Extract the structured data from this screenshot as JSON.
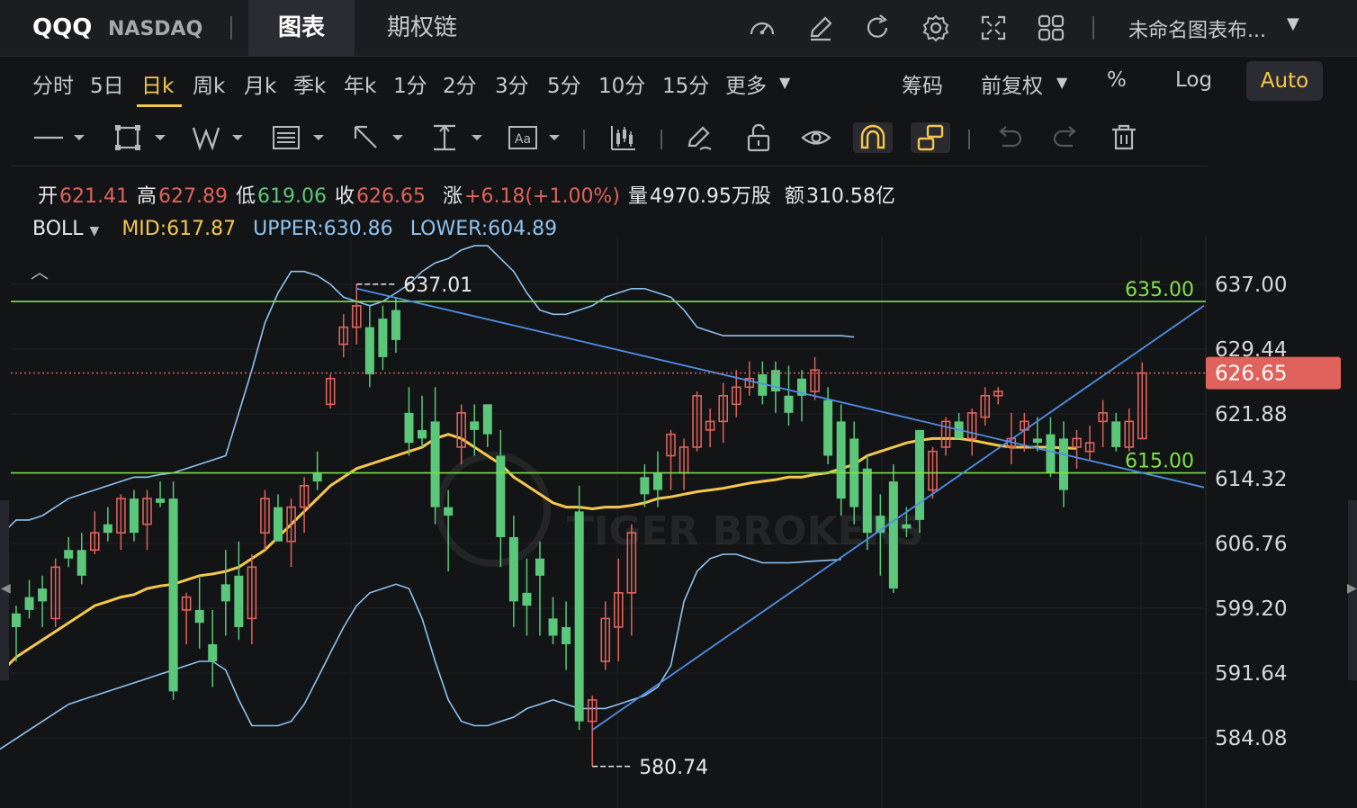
{
  "header": {
    "symbol": "QQQ",
    "exchange": "NASDAQ",
    "tabs": [
      {
        "label": "图表",
        "active": true
      },
      {
        "label": "期权链",
        "active": false
      }
    ],
    "layout_name": "未命名图表布...",
    "icons": [
      "gauge-icon",
      "pencil-icon",
      "refresh-icon",
      "settings-icon",
      "fullscreen-icon",
      "grid-layout-icon"
    ]
  },
  "periods": {
    "items": [
      "分时",
      "5日",
      "日k",
      "周k",
      "月k",
      "季k",
      "年k",
      "1分",
      "2分",
      "3分",
      "5分",
      "10分",
      "15分",
      "更多"
    ],
    "active": "日k",
    "chips": "筹码",
    "adjust": "前复权",
    "percent": "%",
    "log": "Log",
    "auto": "Auto"
  },
  "ohlc": {
    "open_label": "开",
    "open": "621.41",
    "high_label": "高",
    "high": "627.89",
    "low_label": "低",
    "low": "619.06",
    "close_label": "收",
    "close": "626.65",
    "change_label": "涨",
    "change": "+6.18(+1.00%)",
    "volume_label": "量",
    "volume": "4970.95万股",
    "amount_label": "额",
    "amount": "310.58亿"
  },
  "indicator": {
    "name": "BOLL",
    "mid": "MID:617.87",
    "upper": "UPPER:630.86",
    "lower": "LOWER:604.89"
  },
  "colors": {
    "up": "#e0625c",
    "down": "#5bc77b",
    "mid": "#f5c84c",
    "band": "#8ec3f0",
    "trendline": "#4f8fe6",
    "hline": "#7fe04a",
    "accent": "#f5c84c",
    "last_price_bg": "#e0625c"
  },
  "chart_data": {
    "type": "candlestick",
    "y_ticks": [
      "637.00",
      "629.44",
      "621.88",
      "614.32",
      "606.76",
      "599.20",
      "591.64",
      "584.08"
    ],
    "ylim": [
      581.0,
      641.5
    ],
    "last_price": "626.65",
    "hlines": [
      {
        "value": 635.0,
        "label": "635.00"
      },
      {
        "value": 615.0,
        "label": "615.00"
      }
    ],
    "high_marker": {
      "value": "637.01",
      "index": 26
    },
    "low_marker": {
      "value": "580.74",
      "index": 44
    },
    "watermark": "TIGER BROKERS",
    "trendlines": [
      {
        "from": [
          26,
          636.5
        ],
        "to": [
          86,
          615.0
        ]
      },
      {
        "from": [
          44,
          585.0
        ],
        "to": [
          86,
          629.5
        ]
      }
    ],
    "candles": [
      {
        "o": 598.6,
        "h": 599.5,
        "l": 593.0,
        "c": 597.0
      },
      {
        "o": 600.5,
        "h": 602.5,
        "l": 598.0,
        "c": 599.0
      },
      {
        "o": 601.5,
        "h": 603.0,
        "l": 597.0,
        "c": 600.0
      },
      {
        "o": 598.0,
        "h": 605.0,
        "l": 597.0,
        "c": 604.0
      },
      {
        "o": 606.0,
        "h": 607.5,
        "l": 604.0,
        "c": 605.0
      },
      {
        "o": 606.0,
        "h": 608.0,
        "l": 602.0,
        "c": 603.0
      },
      {
        "o": 606.0,
        "h": 610.5,
        "l": 605.5,
        "c": 608.0
      },
      {
        "o": 609.0,
        "h": 611.0,
        "l": 607.0,
        "c": 608.0
      },
      {
        "o": 608.0,
        "h": 612.5,
        "l": 606.0,
        "c": 612.0
      },
      {
        "o": 612.0,
        "h": 613.0,
        "l": 607.0,
        "c": 608.0
      },
      {
        "o": 609.0,
        "h": 613.0,
        "l": 606.0,
        "c": 612.0
      },
      {
        "o": 612.0,
        "h": 614.0,
        "l": 611.0,
        "c": 611.5
      },
      {
        "o": 612.0,
        "h": 614.0,
        "l": 588.5,
        "c": 589.5
      },
      {
        "o": 599.0,
        "h": 601.0,
        "l": 595.0,
        "c": 600.5
      },
      {
        "o": 599.0,
        "h": 603.0,
        "l": 594.5,
        "c": 597.5
      },
      {
        "o": 595.0,
        "h": 599.0,
        "l": 590.0,
        "c": 593.0
      },
      {
        "o": 602.0,
        "h": 606.0,
        "l": 596.0,
        "c": 600.0
      },
      {
        "o": 603.0,
        "h": 607.0,
        "l": 595.5,
        "c": 597.0
      },
      {
        "o": 598.0,
        "h": 605.5,
        "l": 595.0,
        "c": 604.0
      },
      {
        "o": 608.0,
        "h": 613.0,
        "l": 606.0,
        "c": 612.0
      },
      {
        "o": 611.0,
        "h": 612.5,
        "l": 608.0,
        "c": 607.0
      },
      {
        "o": 607.0,
        "h": 612.0,
        "l": 604.0,
        "c": 611.0
      },
      {
        "o": 611.0,
        "h": 614.5,
        "l": 608.0,
        "c": 613.5
      },
      {
        "o": 615.0,
        "h": 617.5,
        "l": 613.0,
        "c": 614.0
      },
      {
        "o": 623.0,
        "h": 626.5,
        "l": 622.5,
        "c": 626.0
      },
      {
        "o": 630.0,
        "h": 633.5,
        "l": 628.5,
        "c": 632.0
      },
      {
        "o": 632.0,
        "h": 637.0,
        "l": 630.0,
        "c": 634.5
      },
      {
        "o": 632.0,
        "h": 634.5,
        "l": 625.0,
        "c": 626.5
      },
      {
        "o": 633.0,
        "h": 634.5,
        "l": 627.0,
        "c": 628.5
      },
      {
        "o": 634.0,
        "h": 635.5,
        "l": 629.0,
        "c": 630.5
      },
      {
        "o": 622.0,
        "h": 625.0,
        "l": 617.0,
        "c": 618.5
      },
      {
        "o": 620.0,
        "h": 624.0,
        "l": 618.0,
        "c": 619.0
      },
      {
        "o": 621.0,
        "h": 625.0,
        "l": 609.0,
        "c": 611.0
      },
      {
        "o": 611.0,
        "h": 613.0,
        "l": 603.5,
        "c": 610.0
      },
      {
        "o": 618.0,
        "h": 623.0,
        "l": 616.0,
        "c": 622.0
      },
      {
        "o": 621.0,
        "h": 623.0,
        "l": 617.0,
        "c": 620.0
      },
      {
        "o": 623.0,
        "h": 623.0,
        "l": 618.0,
        "c": 619.5
      },
      {
        "o": 617.0,
        "h": 620.0,
        "l": 604.0,
        "c": 607.5
      },
      {
        "o": 607.5,
        "h": 610.0,
        "l": 597.0,
        "c": 600.0
      },
      {
        "o": 601.0,
        "h": 605.0,
        "l": 596.0,
        "c": 599.5
      },
      {
        "o": 605.0,
        "h": 607.0,
        "l": 596.0,
        "c": 603.0
      },
      {
        "o": 598.0,
        "h": 600.5,
        "l": 595.0,
        "c": 596.0
      },
      {
        "o": 597.0,
        "h": 600.0,
        "l": 592.0,
        "c": 595.0
      },
      {
        "o": 610.5,
        "h": 613.5,
        "l": 585.0,
        "c": 586.0
      },
      {
        "o": 586.0,
        "h": 589.0,
        "l": 580.74,
        "c": 588.5
      },
      {
        "o": 593.0,
        "h": 600.0,
        "l": 592.0,
        "c": 598.0
      },
      {
        "o": 597.0,
        "h": 605.0,
        "l": 593.0,
        "c": 601.0
      },
      {
        "o": 601.0,
        "h": 609.0,
        "l": 596.0,
        "c": 608.0
      },
      {
        "o": 614.5,
        "h": 616.0,
        "l": 611.0,
        "c": 612.5
      },
      {
        "o": 615.0,
        "h": 617.5,
        "l": 611.0,
        "c": 613.0
      },
      {
        "o": 617.0,
        "h": 620.0,
        "l": 613.0,
        "c": 619.5
      },
      {
        "o": 615.0,
        "h": 619.0,
        "l": 613.0,
        "c": 618.0
      },
      {
        "o": 618.0,
        "h": 624.5,
        "l": 617.5,
        "c": 624.0
      },
      {
        "o": 620.0,
        "h": 622.5,
        "l": 618.0,
        "c": 621.0
      },
      {
        "o": 621.0,
        "h": 625.5,
        "l": 618.5,
        "c": 624.0
      },
      {
        "o": 623.0,
        "h": 627.0,
        "l": 621.5,
        "c": 625.0
      },
      {
        "o": 625.0,
        "h": 628.0,
        "l": 624.0,
        "c": 626.0
      },
      {
        "o": 626.5,
        "h": 628.0,
        "l": 623.0,
        "c": 624.0
      },
      {
        "o": 627.0,
        "h": 628.0,
        "l": 622.0,
        "c": 624.5
      },
      {
        "o": 624.0,
        "h": 627.5,
        "l": 620.5,
        "c": 622.0
      },
      {
        "o": 626.0,
        "h": 627.0,
        "l": 621.0,
        "c": 624.0
      },
      {
        "o": 624.5,
        "h": 628.5,
        "l": 623.5,
        "c": 627.0
      },
      {
        "o": 623.5,
        "h": 625.0,
        "l": 616.0,
        "c": 617.0
      },
      {
        "o": 621.0,
        "h": 623.0,
        "l": 610.0,
        "c": 612.0
      },
      {
        "o": 619.0,
        "h": 621.0,
        "l": 609.0,
        "c": 611.0
      },
      {
        "o": 615.5,
        "h": 617.0,
        "l": 606.0,
        "c": 608.0
      },
      {
        "o": 610.0,
        "h": 612.5,
        "l": 603.0,
        "c": 608.0
      },
      {
        "o": 614.0,
        "h": 616.0,
        "l": 601.0,
        "c": 601.5
      },
      {
        "o": 609.0,
        "h": 611.0,
        "l": 607.5,
        "c": 608.5
      },
      {
        "o": 620.0,
        "h": 620.0,
        "l": 608.0,
        "c": 609.5
      },
      {
        "o": 613.0,
        "h": 618.0,
        "l": 612.0,
        "c": 617.5
      },
      {
        "o": 618.0,
        "h": 621.5,
        "l": 617.0,
        "c": 621.0
      },
      {
        "o": 621.0,
        "h": 622.0,
        "l": 619.5,
        "c": 619.0
      },
      {
        "o": 619.0,
        "h": 622.5,
        "l": 617.0,
        "c": 622.0
      },
      {
        "o": 621.5,
        "h": 625.0,
        "l": 620.5,
        "c": 624.0
      },
      {
        "o": 624.0,
        "h": 625.0,
        "l": 623.0,
        "c": 624.5
      },
      {
        "o": 618.0,
        "h": 622.0,
        "l": 616.0,
        "c": 619.0
      },
      {
        "o": 620.0,
        "h": 622.0,
        "l": 617.5,
        "c": 621.0
      },
      {
        "o": 619.0,
        "h": 621.5,
        "l": 617.5,
        "c": 618.5
      },
      {
        "o": 619.5,
        "h": 621.5,
        "l": 614.5,
        "c": 615.0
      },
      {
        "o": 619.0,
        "h": 621.0,
        "l": 611.0,
        "c": 613.0
      },
      {
        "o": 618.0,
        "h": 620.0,
        "l": 615.5,
        "c": 619.0
      },
      {
        "o": 617.5,
        "h": 620.5,
        "l": 616.5,
        "c": 618.5
      },
      {
        "o": 621.0,
        "h": 623.5,
        "l": 618.0,
        "c": 622.0
      },
      {
        "o": 621.0,
        "h": 622.0,
        "l": 617.5,
        "c": 618.0
      },
      {
        "o": 618.0,
        "h": 622.5,
        "l": 617.5,
        "c": 621.0
      },
      {
        "o": 619.0,
        "h": 627.89,
        "l": 619.06,
        "c": 626.65
      }
    ],
    "mid_line": [
      590.0,
      591.0,
      592.0,
      593.5,
      594.5,
      595.5,
      596.5,
      597.5,
      598.5,
      599.5,
      600.0,
      600.5,
      600.8,
      601.5,
      601.8,
      602.0,
      602.5,
      603.0,
      603.2,
      603.5,
      604.0,
      605.0,
      606.0,
      607.5,
      609.0,
      610.5,
      612.0,
      613.5,
      614.5,
      615.5,
      616.0,
      616.5,
      617.0,
      617.5,
      618.0,
      619.0,
      619.5,
      619.0,
      618.0,
      617.0,
      616.0,
      614.5,
      613.5,
      612.5,
      611.5,
      611.0,
      611.0,
      610.8,
      611.0,
      611.0,
      611.2,
      611.5,
      612.0,
      612.2,
      612.5,
      612.8,
      613.0,
      613.2,
      613.5,
      613.8,
      614.0,
      614.2,
      614.5,
      614.5,
      614.8,
      615.0,
      615.5,
      616.0,
      617.0,
      617.5,
      618.0,
      618.5,
      618.8,
      619.0,
      619.0,
      619.0,
      618.8,
      618.5,
      618.2,
      618.0,
      618.0,
      618.0,
      618.0,
      617.9,
      617.87
    ],
    "upper_band": [
      606.0,
      607.0,
      608.0,
      608.0,
      609.5,
      609.5,
      610.0,
      611.0,
      612.0,
      612.5,
      613.0,
      613.5,
      614.0,
      614.5,
      614.5,
      614.8,
      615.0,
      615.5,
      616.0,
      616.5,
      617.0,
      622.0,
      627.0,
      632.5,
      636.0,
      638.5,
      638.5,
      638.0,
      637.0,
      635.5,
      635.0,
      634.5,
      635.0,
      636.0,
      637.0,
      638.5,
      639.5,
      640.0,
      641.0,
      641.5,
      641.5,
      640.0,
      638.5,
      636.0,
      634.0,
      633.5,
      633.5,
      634.0,
      634.5,
      635.5,
      636.0,
      636.5,
      636.5,
      636.0,
      635.5,
      634.0,
      632.0,
      631.5,
      631.0,
      631.0,
      631.0,
      631.0,
      631.0,
      631.0,
      631.0,
      631.0,
      631.0,
      631.0,
      630.86
    ],
    "lower_band": [
      578.0,
      580.0,
      582.0,
      583.0,
      584.0,
      585.0,
      586.0,
      587.0,
      588.0,
      588.5,
      589.0,
      589.5,
      590.0,
      590.5,
      591.0,
      591.5,
      592.0,
      592.5,
      593.0,
      593.0,
      592.0,
      588.5,
      585.5,
      585.5,
      585.5,
      586.0,
      588.0,
      591.0,
      594.0,
      597.0,
      599.5,
      601.0,
      601.5,
      602.0,
      601.5,
      598.0,
      593.0,
      588.5,
      586.0,
      585.5,
      585.5,
      586.0,
      586.5,
      587.5,
      588.0,
      588.5,
      588.0,
      587.5,
      587.5,
      587.5,
      588.0,
      588.5,
      589.0,
      590.0,
      592.5,
      600.0,
      603.5,
      605.0,
      605.5,
      605.5,
      605.0,
      604.5,
      604.5,
      604.5,
      604.6,
      604.7,
      604.8,
      604.89
    ]
  }
}
